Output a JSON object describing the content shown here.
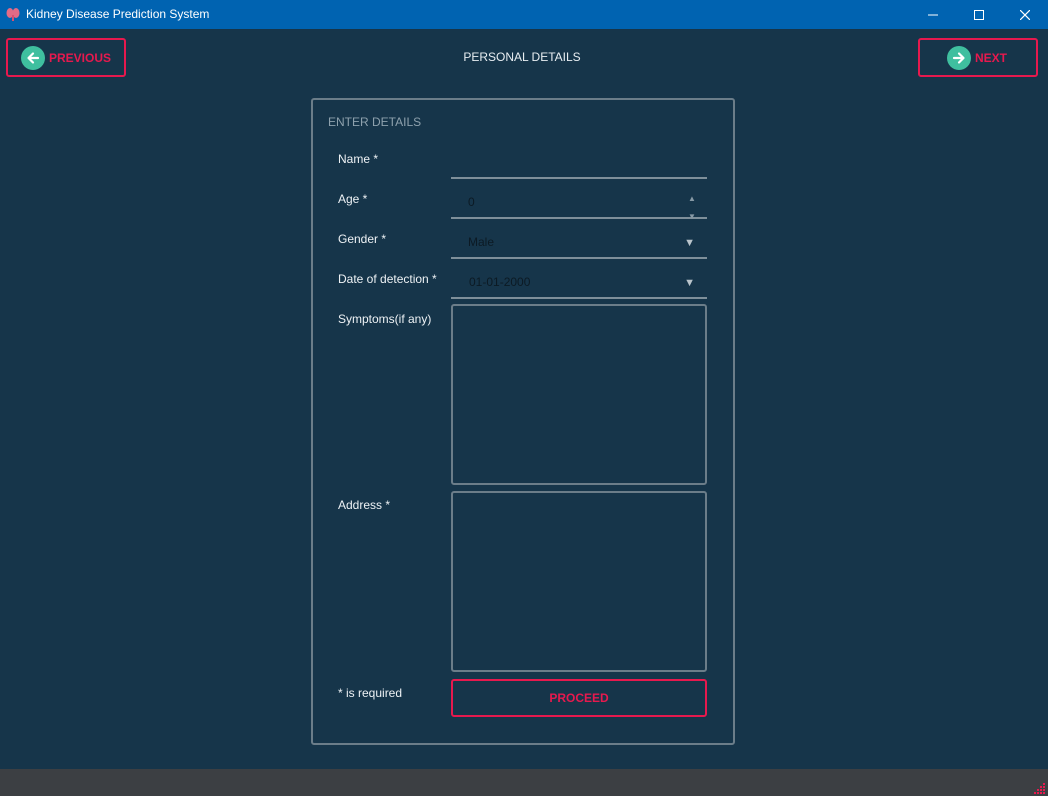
{
  "window": {
    "title": "Kidney Disease Prediction System",
    "icon": "kidney-icon"
  },
  "nav": {
    "previous_label": "PREVIOUS",
    "next_label": "NEXT",
    "page_title": "PERSONAL DETAILS"
  },
  "form": {
    "section_title": "ENTER DETAILS",
    "fields": {
      "name": {
        "label": "Name *",
        "value": ""
      },
      "age": {
        "label": "Age *",
        "value": "0"
      },
      "gender": {
        "label": "Gender *",
        "value": "Male"
      },
      "date": {
        "label": "Date of detection *",
        "value": "01-01-2000"
      },
      "symptoms": {
        "label": "Symptoms(if any)",
        "value": ""
      },
      "address": {
        "label": "Address *",
        "value": ""
      }
    },
    "required_note": "* is required",
    "proceed_label": "PROCEED"
  },
  "colors": {
    "background": "#16354a",
    "accent": "#e7194e",
    "titlebar": "#0063b1",
    "icon_circle": "#3fbf9f"
  }
}
